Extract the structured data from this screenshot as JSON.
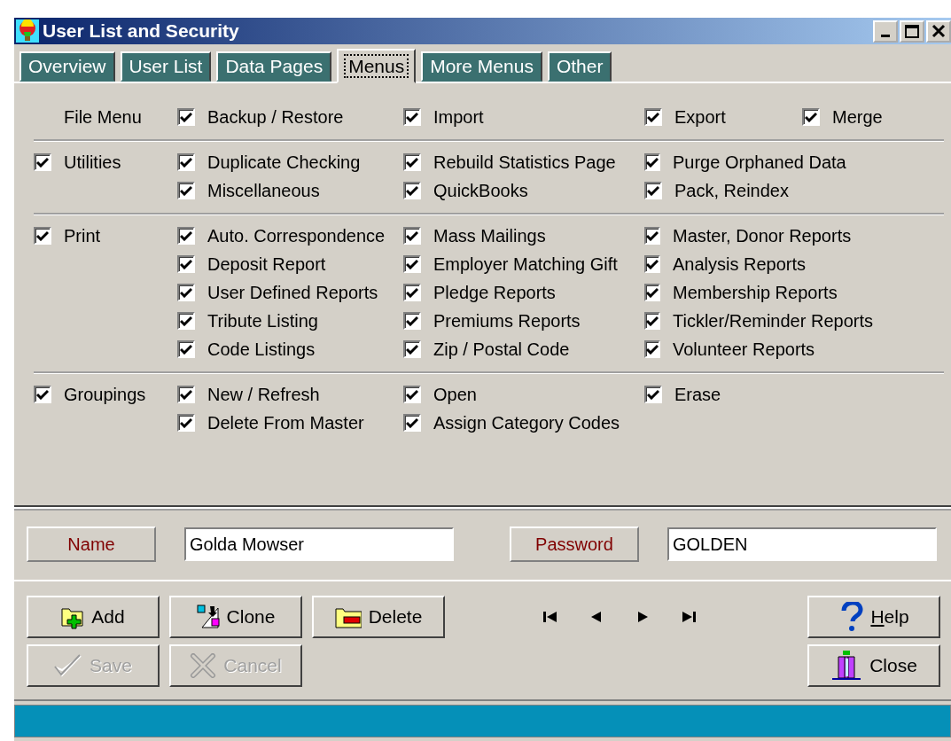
{
  "window": {
    "title": "User List and Security"
  },
  "tabs": [
    {
      "label": "Overview",
      "selected": false
    },
    {
      "label": "User List",
      "selected": false
    },
    {
      "label": "Data Pages",
      "selected": false
    },
    {
      "label": "Menus",
      "selected": true
    },
    {
      "label": "More Menus",
      "selected": false
    },
    {
      "label": "Other",
      "selected": false
    }
  ],
  "sections": [
    {
      "kind": "heading",
      "label": "File Menu",
      "rows": [
        [
          {
            "label": "Backup / Restore",
            "checked": true
          },
          {
            "label": "Import",
            "checked": true
          },
          {
            "label": "Export",
            "checked": true
          },
          {
            "label": "Merge",
            "checked": true
          }
        ]
      ]
    },
    {
      "kind": "checkbox",
      "label": "Utilities",
      "checked": true,
      "rows": [
        [
          {
            "label": "Duplicate Checking",
            "checked": true
          },
          {
            "label": "Rebuild Statistics Page",
            "checked": true
          },
          {
            "label": "Purge Orphaned Data",
            "checked": true
          }
        ],
        [
          {
            "label": "Miscellaneous",
            "checked": true
          },
          {
            "label": "QuickBooks",
            "checked": true
          },
          {
            "label": "Pack, Reindex",
            "checked": true
          }
        ]
      ]
    },
    {
      "kind": "checkbox",
      "label": "Print",
      "checked": true,
      "rows": [
        [
          {
            "label": "Auto. Correspondence",
            "checked": true
          },
          {
            "label": "Mass Mailings",
            "checked": true
          },
          {
            "label": "Master, Donor Reports",
            "checked": true
          }
        ],
        [
          {
            "label": "Deposit Report",
            "checked": true
          },
          {
            "label": "Employer Matching Gift",
            "checked": true
          },
          {
            "label": "Analysis Reports",
            "checked": true
          }
        ],
        [
          {
            "label": "User Defined Reports",
            "checked": true
          },
          {
            "label": "Pledge Reports",
            "checked": true
          },
          {
            "label": "Membership Reports",
            "checked": true
          }
        ],
        [
          {
            "label": "Tribute Listing",
            "checked": true
          },
          {
            "label": "Premiums Reports",
            "checked": true
          },
          {
            "label": "Tickler/Reminder Reports",
            "checked": true
          }
        ],
        [
          {
            "label": "Code Listings",
            "checked": true
          },
          {
            "label": "Zip / Postal Code",
            "checked": true
          },
          {
            "label": "Volunteer Reports",
            "checked": true
          }
        ]
      ]
    },
    {
      "kind": "checkbox",
      "label": "Groupings",
      "checked": true,
      "rows": [
        [
          {
            "label": "New / Refresh",
            "checked": true
          },
          {
            "label": "Open",
            "checked": true
          },
          {
            "label": "Erase",
            "checked": true
          }
        ],
        [
          {
            "label": "Delete From Master",
            "checked": true
          },
          {
            "label": "Assign Category Codes",
            "checked": true
          }
        ]
      ]
    }
  ],
  "fields": [
    {
      "label": "Name",
      "value": "Golda Mowser"
    },
    {
      "label": "Password",
      "value": "GOLDEN"
    }
  ],
  "buttons": [
    {
      "kind": "add",
      "label": "Add",
      "disabled": false
    },
    {
      "kind": "clone",
      "label": "Clone",
      "disabled": false
    },
    {
      "kind": "delete",
      "label": "Delete",
      "disabled": false
    },
    {
      "kind": "help",
      "label": "Help",
      "disabled": false,
      "first_letter_underlined": true
    },
    {
      "kind": "save",
      "label": "Save",
      "disabled": true
    },
    {
      "kind": "cancel",
      "label": "Cancel",
      "disabled": true
    },
    {
      "kind": "close",
      "label": "Close",
      "disabled": false
    }
  ],
  "navigation": [
    {
      "kind": "first"
    },
    {
      "kind": "previous"
    },
    {
      "kind": "next"
    },
    {
      "kind": "last"
    }
  ]
}
